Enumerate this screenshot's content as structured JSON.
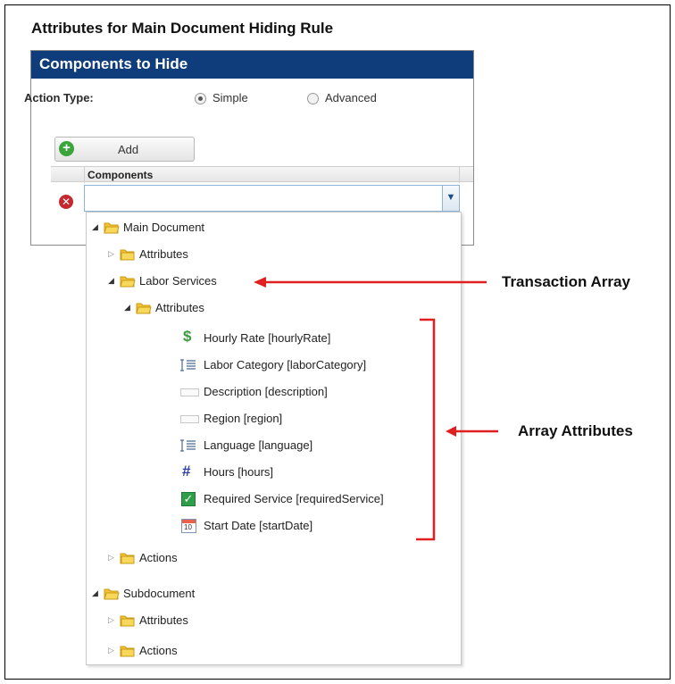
{
  "section_title": "Attributes for Main Document Hiding Rule",
  "panel": {
    "title": "Components to Hide",
    "action_type_label": "Action Type:",
    "radios": [
      {
        "label": "Simple",
        "checked": true
      },
      {
        "label": "Advanced",
        "checked": false
      }
    ],
    "add_button_label": "Add",
    "grid": {
      "components_header": "Components",
      "combo_value": ""
    }
  },
  "tree": {
    "main_document": "Main Document",
    "main_attributes": "Attributes",
    "labor_services": "Labor Services",
    "labor_attributes": "Attributes",
    "leaves": [
      {
        "label": "Hourly Rate [hourlyRate]",
        "icon": "currency-icon"
      },
      {
        "label": "Labor Category [laborCategory]",
        "icon": "list-icon"
      },
      {
        "label": "Description [description]",
        "icon": "textbox-icon"
      },
      {
        "label": "Region [region]",
        "icon": "textbox-icon"
      },
      {
        "label": "Language [language]",
        "icon": "list-icon"
      },
      {
        "label": "Hours [hours]",
        "icon": "number-icon"
      },
      {
        "label": "Required Service [requiredService]",
        "icon": "checkbox-icon"
      },
      {
        "label": "Start Date [startDate]",
        "icon": "calendar-icon"
      }
    ],
    "labor_actions": "Actions",
    "subdocument": "Subdocument",
    "sub_attributes": "Attributes",
    "sub_actions": "Actions"
  },
  "annotations": {
    "transaction_array": "Transaction Array",
    "array_attributes": "Array Attributes",
    "color": "#e02020"
  },
  "colors": {
    "header_bg": "#0f3c7a",
    "folder": "#f2c233"
  }
}
